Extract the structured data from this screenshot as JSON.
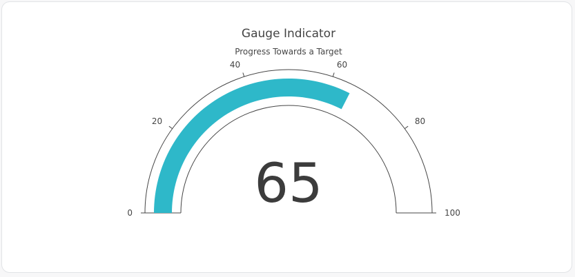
{
  "chart_data": {
    "type": "gauge",
    "title": "Gauge Indicator",
    "subtitle": "Progress Towards a Target",
    "value": 65,
    "value_label": "65",
    "range": [
      0,
      100
    ],
    "ticks": [
      {
        "value": 0,
        "label": "0"
      },
      {
        "value": 20,
        "label": "20"
      },
      {
        "value": 40,
        "label": "40"
      },
      {
        "value": 60,
        "label": "60"
      },
      {
        "value": 80,
        "label": "80"
      },
      {
        "value": 100,
        "label": "100"
      }
    ],
    "bar_color": "#2eb8c9",
    "text_color": "#3c3c3c"
  }
}
